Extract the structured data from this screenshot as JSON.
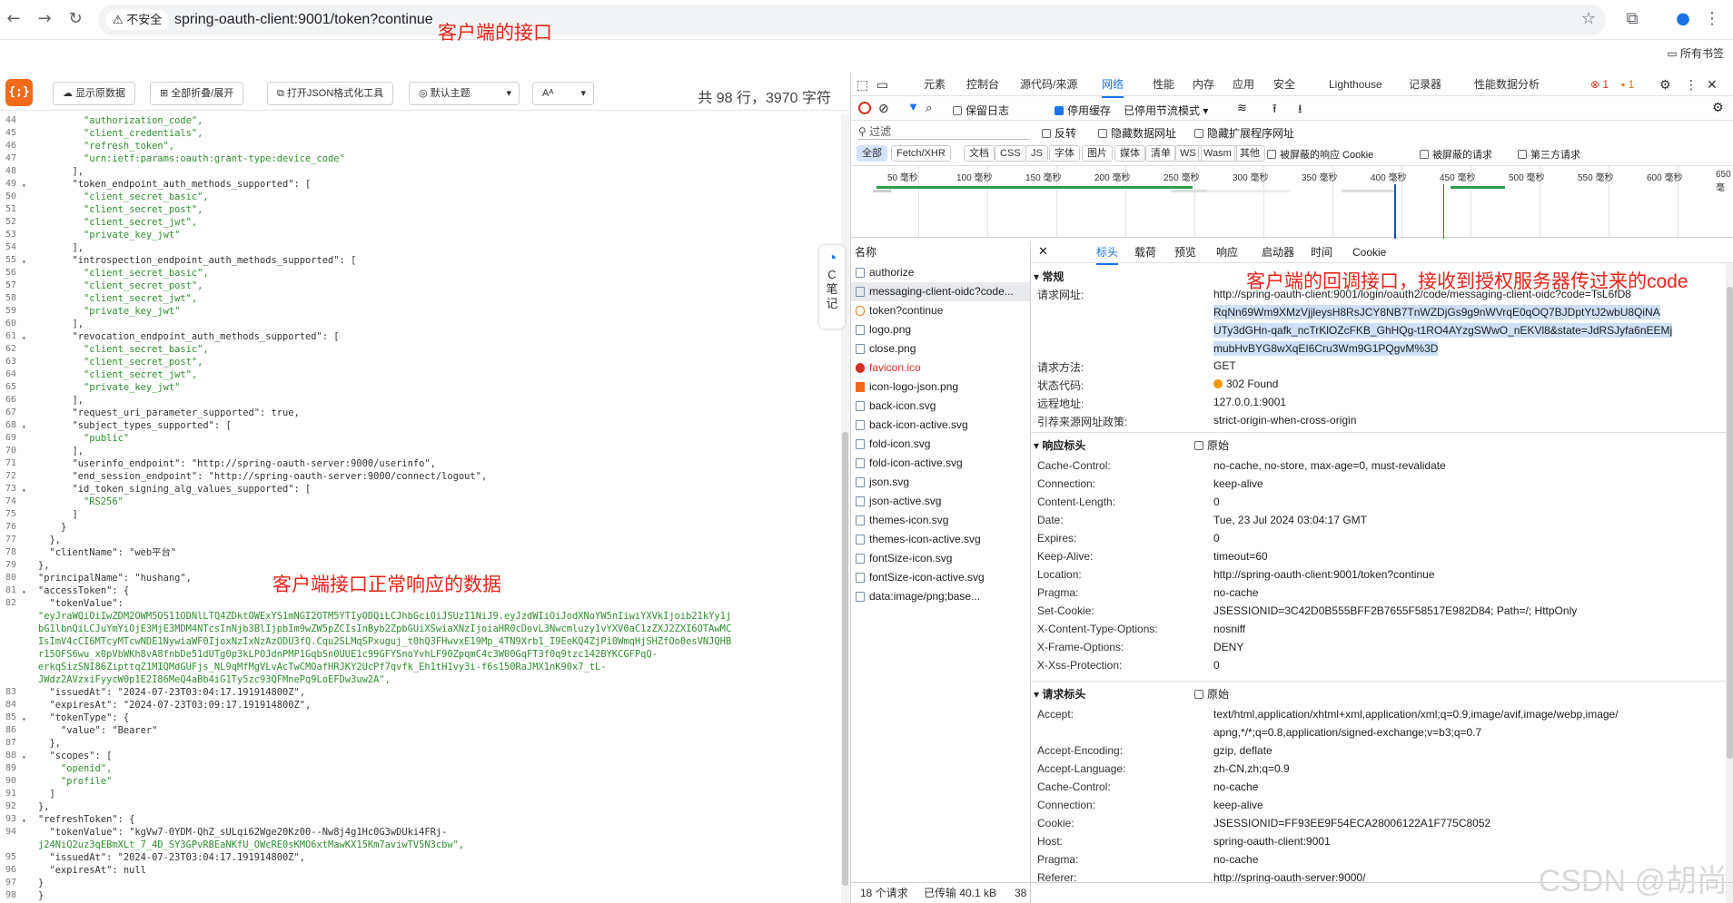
{
  "browser": {
    "insecure": "不安全",
    "url": "spring-oauth-client:9001/token?continue",
    "bookmarks": "所有书签",
    "annotation_url": "客户端的接口"
  },
  "json_viewer": {
    "btn_raw": "显示原数据",
    "btn_fold": "全部折叠/展开",
    "btn_tool": "打开JSON格式化工具",
    "btn_theme": "默认主题",
    "stats": "共 98 行，3970 字符",
    "annotation": "客户端接口正常响应的数据",
    "note_label": "C 笔 记"
  },
  "code_lines": [
    {
      "n": "44",
      "t": "        \"authorization_code\",",
      "c": "s"
    },
    {
      "n": "45",
      "t": "        \"client_credentials\",",
      "c": "s"
    },
    {
      "n": "46",
      "t": "        \"refresh_token\",",
      "c": "s"
    },
    {
      "n": "47",
      "t": "        \"urn:ietf:params:oauth:grant-type:device_code\"",
      "c": "s"
    },
    {
      "n": "48",
      "t": "      ],",
      "c": "k"
    },
    {
      "n": "49",
      "t": "      \"token_endpoint_auth_methods_supported\": [",
      "c": "k"
    },
    {
      "n": "50",
      "t": "        \"client_secret_basic\",",
      "c": "s"
    },
    {
      "n": "51",
      "t": "        \"client_secret_post\",",
      "c": "s"
    },
    {
      "n": "52",
      "t": "        \"client_secret_jwt\",",
      "c": "s"
    },
    {
      "n": "53",
      "t": "        \"private_key_jwt\"",
      "c": "s"
    },
    {
      "n": "54",
      "t": "      ],",
      "c": "k"
    },
    {
      "n": "55",
      "t": "      \"introspection_endpoint_auth_methods_supported\": [",
      "c": "k"
    },
    {
      "n": "56",
      "t": "        \"client_secret_basic\",",
      "c": "s"
    },
    {
      "n": "57",
      "t": "        \"client_secret_post\",",
      "c": "s"
    },
    {
      "n": "58",
      "t": "        \"client_secret_jwt\",",
      "c": "s"
    },
    {
      "n": "59",
      "t": "        \"private_key_jwt\"",
      "c": "s"
    },
    {
      "n": "60",
      "t": "      ],",
      "c": "k"
    },
    {
      "n": "61",
      "t": "      \"revocation_endpoint_auth_methods_supported\": [",
      "c": "k"
    },
    {
      "n": "62",
      "t": "        \"client_secret_basic\",",
      "c": "s"
    },
    {
      "n": "63",
      "t": "        \"client_secret_post\",",
      "c": "s"
    },
    {
      "n": "64",
      "t": "        \"client_secret_jwt\",",
      "c": "s"
    },
    {
      "n": "65",
      "t": "        \"private_key_jwt\"",
      "c": "s"
    },
    {
      "n": "66",
      "t": "      ],",
      "c": "k"
    },
    {
      "n": "67",
      "t": "      \"request_uri_parameter_supported\": true,",
      "c": "k"
    },
    {
      "n": "68",
      "t": "      \"subject_types_supported\": [",
      "c": "k"
    },
    {
      "n": "69",
      "t": "        \"public\"",
      "c": "s"
    },
    {
      "n": "70",
      "t": "      ],",
      "c": "k"
    },
    {
      "n": "71",
      "t": "      \"userinfo_endpoint\": \"http://spring-oauth-server:9000/userinfo\",",
      "c": "k"
    },
    {
      "n": "72",
      "t": "      \"end_session_endpoint\": \"http://spring-oauth-server:9000/connect/logout\",",
      "c": "k"
    },
    {
      "n": "73",
      "t": "      \"id_token_signing_alg_values_supported\": [",
      "c": "k"
    },
    {
      "n": "74",
      "t": "        \"RS256\"",
      "c": "s"
    },
    {
      "n": "75",
      "t": "      ]",
      "c": "k"
    },
    {
      "n": "76",
      "t": "    }",
      "c": "k"
    },
    {
      "n": "77",
      "t": "  },",
      "c": "k"
    },
    {
      "n": "78",
      "t": "  \"clientName\": \"web平台\"",
      "c": "k"
    },
    {
      "n": "79",
      "t": "},",
      "c": "k"
    },
    {
      "n": "80",
      "t": "\"principalName\": \"hushang\",",
      "c": "k"
    },
    {
      "n": "81",
      "t": "\"accessToken\": {",
      "c": "k"
    },
    {
      "n": "82",
      "t": "  \"tokenValue\":",
      "c": "k"
    },
    {
      "n": "",
      "t": "\"eyJraWQiOiIwZDM2OWM5OS11ODNlLTQ4ZDktOWExYS1mNGI2OTM5YTIyODQiLCJhbGciOiJSUzI1NiJ9.eyJzdWIiOiJodXNoYW5nIiwiYXVkIjoib21kYy1j",
      "c": "s"
    },
    {
      "n": "",
      "t": "bG1lbnQiLCJuYmYiOjE3MjE3MDM4NTcsInNjb3BlIjpbIm9wZW5pZCIsInByb2ZpbGUiXSwiaXNzIjoiaHR0cDovL3Nwcmluzy1vYXV0aC1zZXJ2ZXI6OTAwMC",
      "c": "s"
    },
    {
      "n": "",
      "t": "IsImV4cCI6MTcyMTcwNDE1NywiaWF0IjoxNzIxNzAzODU3fQ.Cqu2SLMqSPxuguj_t0hQ3FHwvxE19Mp_4TN9Xrb1_I9EeKQ4ZjPi0WmqHjSHZfOo0esVNJQHB",
      "c": "s"
    },
    {
      "n": "",
      "t": "r15OFS6wu_x0pVbWKh8vA8fnbDe51dUTg0p3kLPOJdnPMP1GqbSn0UUE1c99GFYSnoYvhLF90ZpqmC4c3W00GqFT3f0q9tzc142BYKCGFPqQ-",
      "c": "s"
    },
    {
      "n": "",
      "t": "erkqSizSNI86ZipttqZ1MIQMdGUFjs_NL9qMfMgVLvAcTwCMOafHRJKY2UcPf7qvfk_Eh1tH1vy3i-f6s150RaJMX1nK90x7_tL-",
      "c": "s"
    },
    {
      "n": "",
      "t": "JWdz2AVzxiFyycW0p1E2I86MeQ4aBb4iG1Ty5zc93QFMnePq9LoEFDw3uw2A\",",
      "c": "s"
    },
    {
      "n": "83",
      "t": "  \"issuedAt\": \"2024-07-23T03:04:17.191914800Z\",",
      "c": "k"
    },
    {
      "n": "84",
      "t": "  \"expiresAt\": \"2024-07-23T03:09:17.191914800Z\",",
      "c": "k"
    },
    {
      "n": "85",
      "t": "  \"tokenType\": {",
      "c": "k"
    },
    {
      "n": "86",
      "t": "    \"value\": \"Bearer\"",
      "c": "k"
    },
    {
      "n": "87",
      "t": "  },",
      "c": "k"
    },
    {
      "n": "88",
      "t": "  \"scopes\": [",
      "c": "k"
    },
    {
      "n": "89",
      "t": "    \"openid\",",
      "c": "s"
    },
    {
      "n": "90",
      "t": "    \"profile\"",
      "c": "s"
    },
    {
      "n": "91",
      "t": "  ]",
      "c": "k"
    },
    {
      "n": "92",
      "t": "},",
      "c": "k"
    },
    {
      "n": "93",
      "t": "\"refreshToken\": {",
      "c": "k"
    },
    {
      "n": "94",
      "t": "  \"tokenValue\": \"kgVw7-0YDM-QhZ_sULqi62Wge20Kz00--Nw8j4g1Hc0G3wDUki4FRj-",
      "c": "k"
    },
    {
      "n": "",
      "t": "j24NiQ2uz3qEBmXLt_7_4D_SY3GPvRBEaNKfU_OWcRE0sKMO6xtMawKX15Km7aviwTV5N3cbw\",",
      "c": "s"
    },
    {
      "n": "95",
      "t": "  \"issuedAt\": \"2024-07-23T03:04:17.191914800Z\",",
      "c": "k"
    },
    {
      "n": "96",
      "t": "  \"expiresAt\": null",
      "c": "k"
    },
    {
      "n": "97",
      "t": "}",
      "c": "k"
    },
    {
      "n": "98",
      "t": "}",
      "c": "k"
    }
  ],
  "devtools": {
    "tabs": [
      "元素",
      "控制台",
      "源代码/来源",
      "网络",
      "性能",
      "内存",
      "应用",
      "安全",
      "Lighthouse",
      "记录器",
      "性能数据分析"
    ],
    "errors": "1",
    "warnings": "1",
    "nettool": {
      "preserve": "保留日志",
      "disable_cache": "停用缓存",
      "throttle": "已停用节流模式"
    },
    "filter": {
      "placeholder": "过滤",
      "invert": "反转",
      "hide_data": "隐藏数据网址",
      "hide_ext": "隐藏扩展程序网址"
    },
    "types": [
      "全部",
      "Fetch/XHR",
      "文档",
      "CSS",
      "JS",
      "字体",
      "图片",
      "媒体",
      "清单",
      "WS",
      "Wasm",
      "其他"
    ],
    "blocked_cookies": "被屏蔽的响应 Cookie",
    "blocked_req": "被屏蔽的请求",
    "third_party": "第三方请求",
    "ticks": [
      "50 毫秒",
      "100 毫秒",
      "150 毫秒",
      "200 毫秒",
      "250 毫秒",
      "300 毫秒",
      "350 毫秒",
      "400 毫秒",
      "450 毫秒",
      "500 毫秒",
      "550 毫秒",
      "600 毫秒",
      "650 毫"
    ],
    "name_header": "名称",
    "requests": [
      "authorize",
      "messaging-client-oidc?code...",
      "token?continue",
      "logo.png",
      "close.png",
      "favicon.ico",
      "icon-logo-json.png",
      "back-icon.svg",
      "back-icon-active.svg",
      "fold-icon.svg",
      "fold-icon-active.svg",
      "json.svg",
      "json-active.svg",
      "themes-icon.svg",
      "themes-icon-active.svg",
      "fontSize-icon.svg",
      "fontSize-icon-active.svg",
      "data:image/png;base..."
    ],
    "detail_tabs": [
      "标头",
      "载荷",
      "预览",
      "响应",
      "启动器",
      "时间",
      "Cookie"
    ],
    "annotation": "客户端的回调接口，接收到授权服务器传过来的code",
    "general": {
      "title": "常规",
      "url_label": "请求网址:",
      "url_lines": [
        "http://spring-oauth-client:9001/login/oauth2/code/messaging-client-oidc?code=TsL6fD8",
        "RqNn69Wm9XMzVjjleysH8RsJCY8NB7TnWZDjGs9g9nWVrqE0qOQ7BJDptYtJ2wbU8QiNA",
        "UTy3dGHn-qafk_ncTrKlOZcFKB_GhHQg-t1RO4AYzgSWwO_nEKVl8&state=JdRSJyfa6nEEMj",
        "mubHvBYG8wXqEI6Cru3Wm9G1PQgvM%3D"
      ],
      "method_label": "请求方法:",
      "method": "GET",
      "status_label": "状态代码:",
      "status": "302 Found",
      "remote_label": "远程地址:",
      "remote": "127.0.0.1:9001",
      "referrer_label": "引荐来源网址政策:",
      "referrer": "strict-origin-when-cross-origin"
    },
    "resp_title": "响应标头",
    "raw": "原始",
    "resp_headers": [
      [
        "Cache-Control:",
        "no-cache, no-store, max-age=0, must-revalidate"
      ],
      [
        "Connection:",
        "keep-alive"
      ],
      [
        "Content-Length:",
        "0"
      ],
      [
        "Date:",
        "Tue, 23 Jul 2024 03:04:17 GMT"
      ],
      [
        "Expires:",
        "0"
      ],
      [
        "Keep-Alive:",
        "timeout=60"
      ],
      [
        "Location:",
        "http://spring-oauth-client:9001/token?continue"
      ],
      [
        "Pragma:",
        "no-cache"
      ],
      [
        "Set-Cookie:",
        "JSESSIONID=3C42D0B555BFF2B7655F58517E982D84; Path=/; HttpOnly"
      ],
      [
        "X-Content-Type-Options:",
        "nosniff"
      ],
      [
        "X-Frame-Options:",
        "DENY"
      ],
      [
        "X-Xss-Protection:",
        "0"
      ]
    ],
    "req_title": "请求标头",
    "accept_label": "Accept:",
    "accept_lines": [
      "text/html,application/xhtml+xml,application/xml;q=0.9,image/avif,image/webp,image/",
      "apng,*/*;q=0.8,application/signed-exchange;v=b3;q=0.7"
    ],
    "req_headers": [
      [
        "Accept-Encoding:",
        "gzip, deflate"
      ],
      [
        "Accept-Language:",
        "zh-CN,zh;q=0.9"
      ],
      [
        "Cache-Control:",
        "no-cache"
      ],
      [
        "Connection:",
        "keep-alive"
      ],
      [
        "Cookie:",
        "JSESSIONID=FF93EE9F54ECA28006122A1F775C8052"
      ],
      [
        "Host:",
        "spring-oauth-client:9001"
      ],
      [
        "Pragma:",
        "no-cache"
      ],
      [
        "Referer:",
        "http://spring-oauth-server:9000/"
      ]
    ],
    "status": {
      "count": "18 个请求",
      "transferred": "已传输 40.1 kB",
      "more": "38"
    }
  },
  "watermark": "CSDN @胡尚",
  "colors": {
    "accent": "#1a73e8",
    "annotation": "#e8251b",
    "json_logo": "#f26b1d",
    "string": "#2f8f2f"
  }
}
